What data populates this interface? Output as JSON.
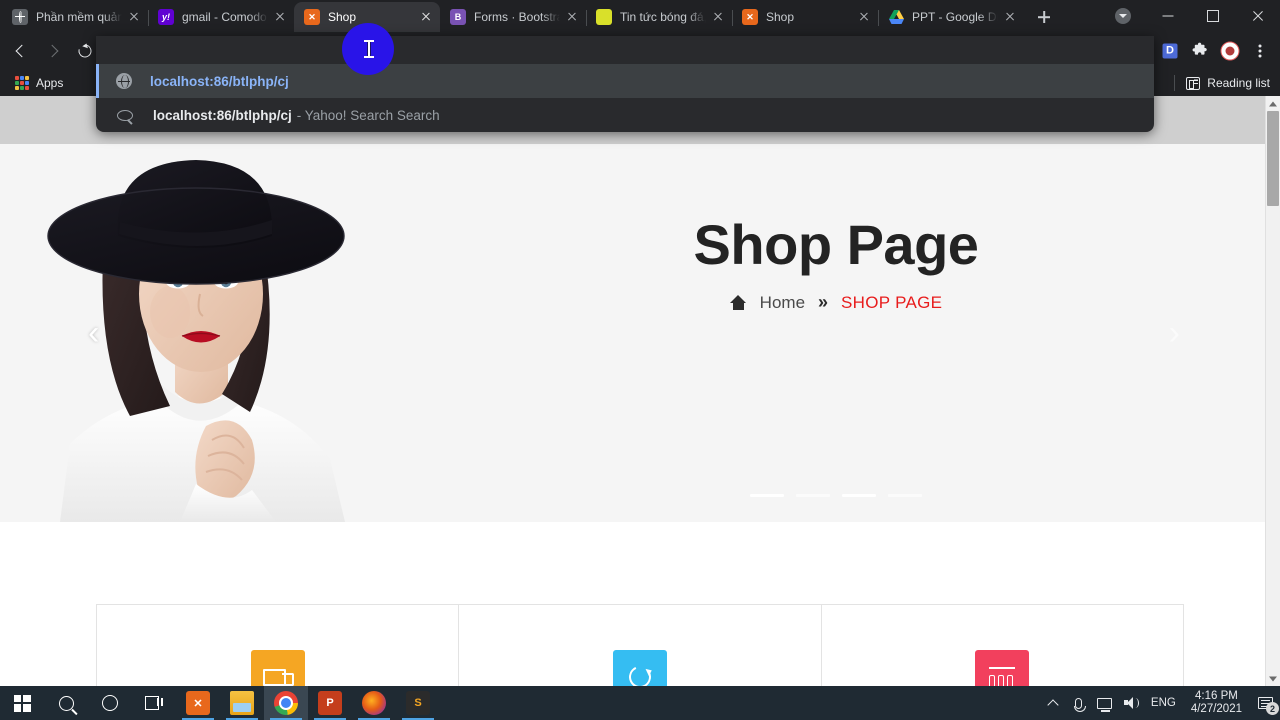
{
  "browser": {
    "tabs": [
      {
        "title": "Phần mềm quản l",
        "favicon": "globe-icon",
        "active": false
      },
      {
        "title": "gmail - Comodo",
        "favicon": "yahoo-icon",
        "active": false
      },
      {
        "title": "Shop",
        "favicon": "xampp-icon",
        "active": true
      },
      {
        "title": "Forms · Bootstrap",
        "favicon": "bootstrap-icon",
        "active": false
      },
      {
        "title": "Tin tức bóng đá,",
        "favicon": "football-icon",
        "active": false
      },
      {
        "title": "Shop",
        "favicon": "xampp-icon",
        "active": false
      },
      {
        "title": "PPT - Google Dri",
        "favicon": "google-drive-icon",
        "active": false
      }
    ],
    "new_tab_label": "+",
    "window_controls": {
      "minimize": "–",
      "maximize": "▢",
      "close": "✕"
    },
    "toolbar": {
      "back": "back-arrow",
      "forward": "forward-arrow",
      "reload": "reload-arrow",
      "url_typed": "localhost",
      "url_rest": ":86/btlphp/cj",
      "profile_badge": "D",
      "extensions": "puzzle-icon",
      "avatar": "avatar-icon",
      "menu": "three-dot-menu"
    },
    "bookmarks": {
      "apps_label": "Apps",
      "reading_list_label": "Reading list"
    },
    "omnibox_dropdown": [
      {
        "icon": "globe-icon",
        "text": "localhost:86/btlphp/cj",
        "suffix": "",
        "selected": true
      },
      {
        "icon": "search-icon",
        "text": "localhost:86/btlphp/cj",
        "suffix": "- Yahoo! Search Search",
        "selected": false
      }
    ]
  },
  "page": {
    "title": "Shop Page",
    "breadcrumb": {
      "home_icon": "home-icon",
      "home_label": "Home",
      "separator": "»",
      "current": "SHOP PAGE"
    },
    "carousel": {
      "prev": "‹",
      "next": "›",
      "indicator_count": 4
    },
    "feature_cards": [
      {
        "icon": "truck-icon",
        "color": "#f5a623"
      },
      {
        "icon": "refresh-icon",
        "color": "#35bdf2"
      },
      {
        "icon": "support-icon",
        "color": "#f2405d"
      }
    ],
    "colors": {
      "accent_red": "#e81c1c",
      "heading": "#232323",
      "hero_bg": "#f5f5f5"
    }
  },
  "taskbar": {
    "items": [
      {
        "name": "start-button",
        "icon": "windows-logo"
      },
      {
        "name": "search-button",
        "icon": "search-icon"
      },
      {
        "name": "cortana-button",
        "icon": "circle-icon"
      },
      {
        "name": "task-view-button",
        "icon": "task-view-icon"
      },
      {
        "name": "xampp-app",
        "icon": "xampp-icon"
      },
      {
        "name": "file-explorer-app",
        "icon": "folder-icon"
      },
      {
        "name": "chrome-app",
        "icon": "chrome-icon"
      },
      {
        "name": "powerpoint-app",
        "icon": "powerpoint-icon",
        "label": "P"
      },
      {
        "name": "firefox-app",
        "icon": "firefox-icon"
      },
      {
        "name": "sublime-app",
        "icon": "sublime-icon",
        "label": "S"
      }
    ],
    "tray": {
      "language": "ENG",
      "time": "4:16 PM",
      "date": "4/27/2021",
      "notification_count": "2"
    }
  }
}
